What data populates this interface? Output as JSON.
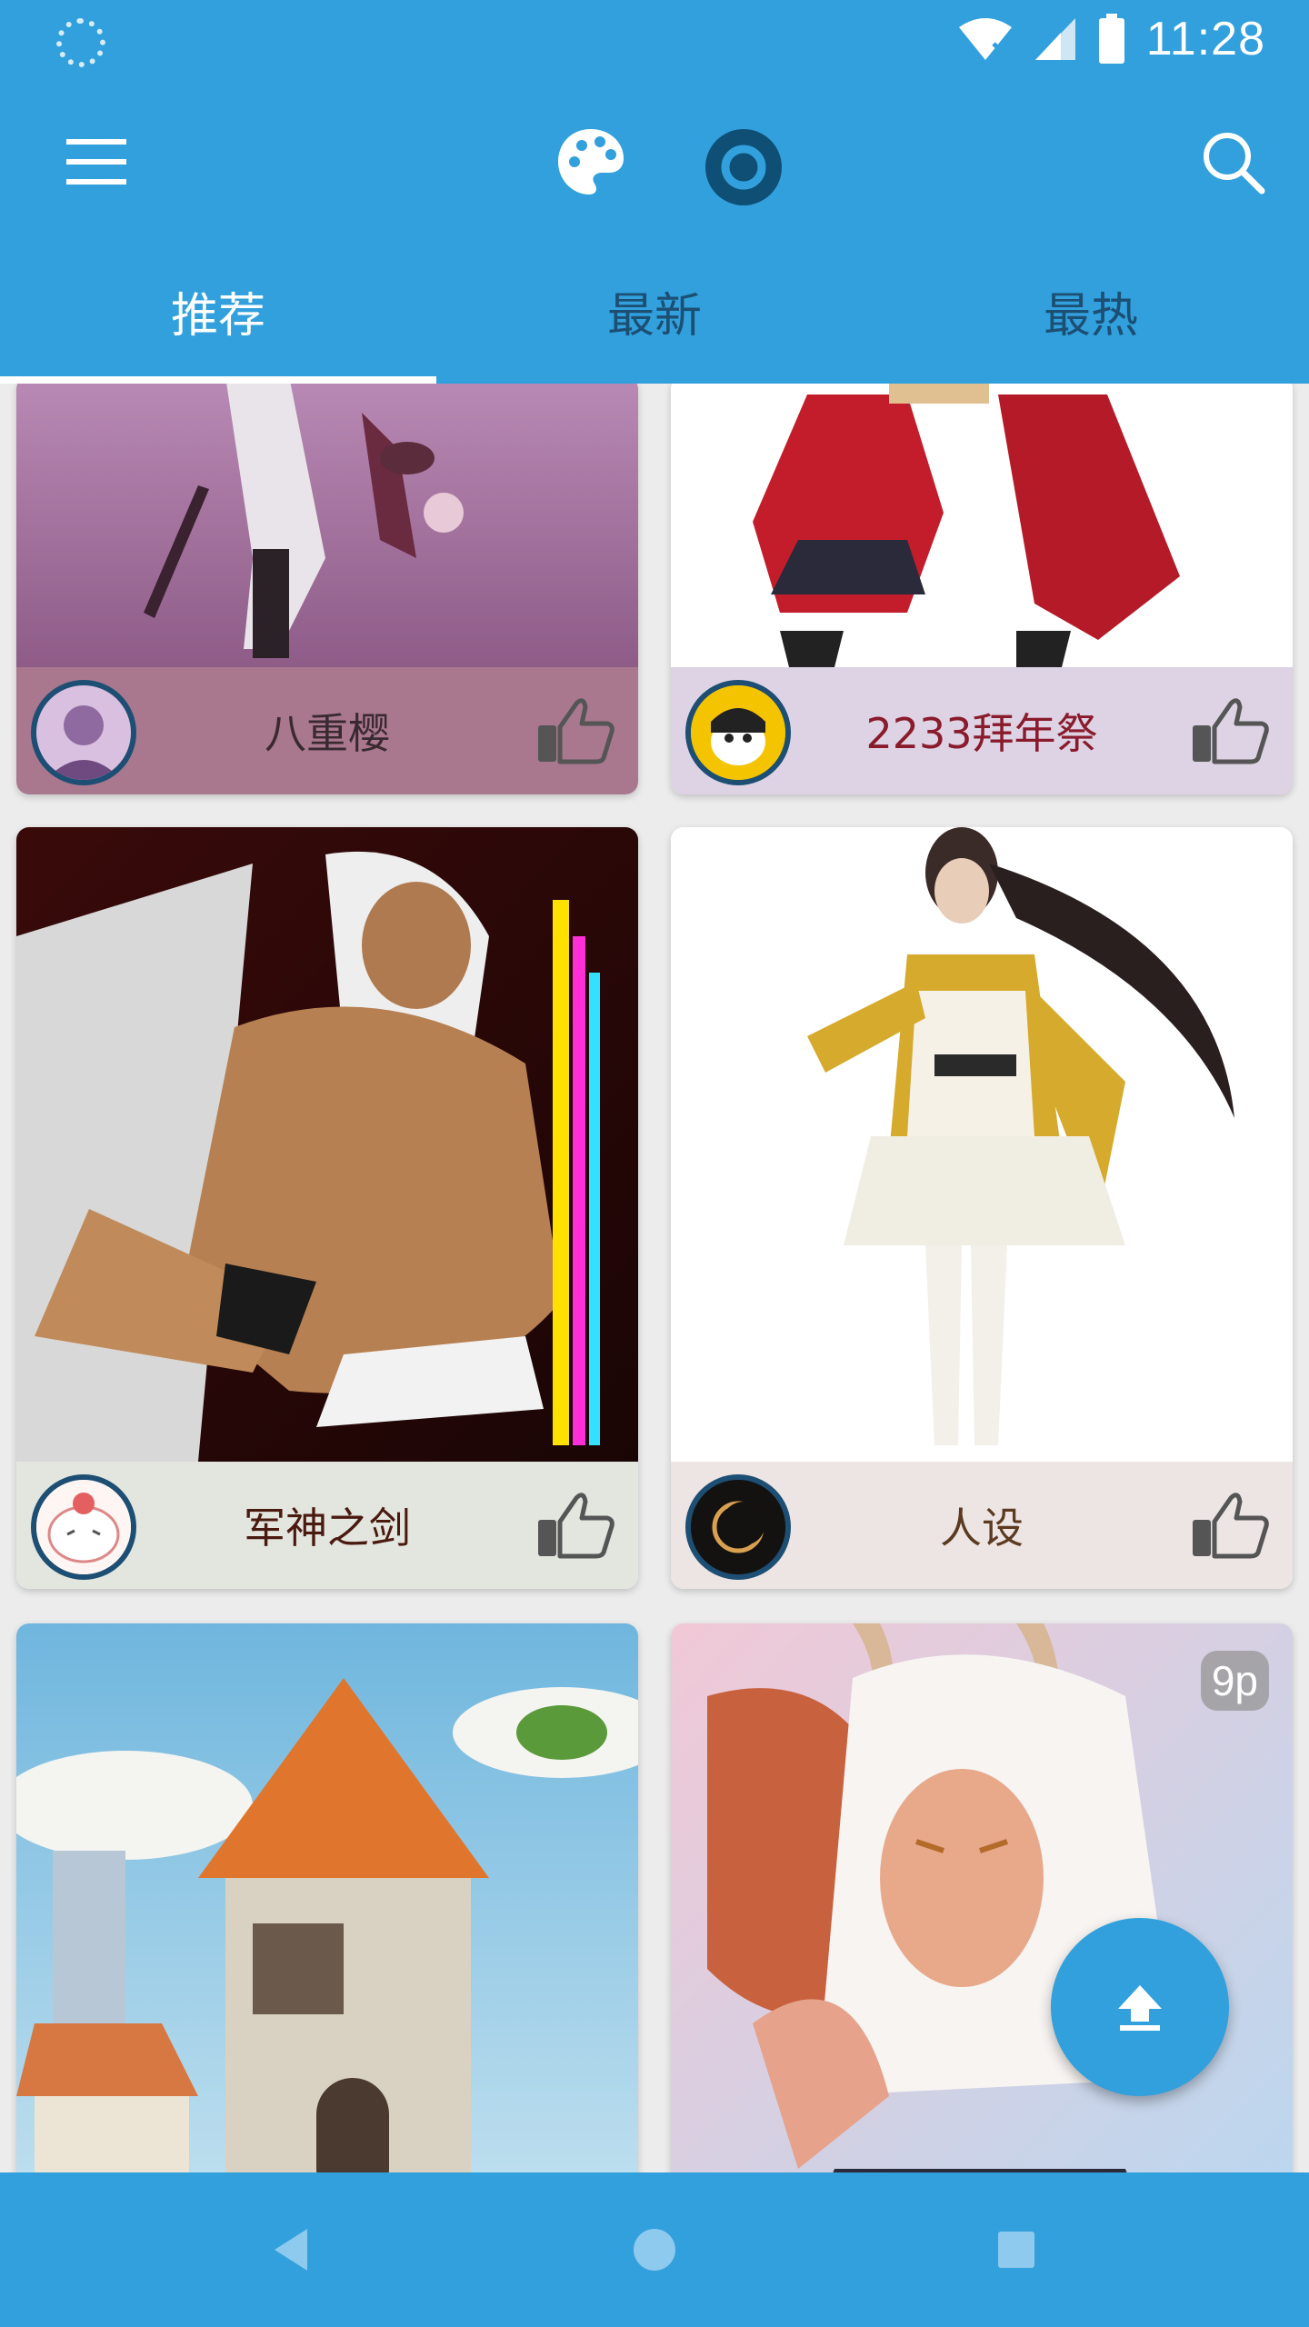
{
  "status_bar": {
    "time": "11:28",
    "wifi_icon": "wifi-x-icon",
    "signal_icon": "signal-icon",
    "battery_icon": "battery-icon",
    "sync_icon": "sync-icon"
  },
  "app_bar": {
    "menu_icon": "menu-icon",
    "palette_icon": "palette-icon",
    "target_icon": "target-icon",
    "search_icon": "search-icon"
  },
  "tabs": [
    {
      "label": "推荐",
      "active": true
    },
    {
      "label": "最新",
      "active": false
    },
    {
      "label": "最热",
      "active": false
    }
  ],
  "cards": [
    {
      "title": "八重樱",
      "foot_color": "#a9788f",
      "title_color": "#3a2a30"
    },
    {
      "title": "2233拜年祭",
      "foot_color": "#ddd3e4",
      "title_color": "#8a1b2c"
    },
    {
      "title": "军神之剑",
      "foot_color": "#e3e6df",
      "title_color": "#4a1a10"
    },
    {
      "title": "人设",
      "foot_color": "#ede4e4",
      "title_color": "#5a3a20"
    },
    {
      "title": "",
      "foot_color": "#ffffff",
      "title_color": "#333333"
    },
    {
      "title": "",
      "foot_color": "#ffffff",
      "title_color": "#333333",
      "badge": "9p"
    }
  ],
  "fab": {
    "icon": "upload-icon"
  },
  "nav": {
    "back_icon": "back-icon",
    "home_icon": "home-icon",
    "recents_icon": "recents-icon"
  },
  "colors": {
    "primary": "#31a0dc",
    "dark_accent": "#1d4e73"
  }
}
